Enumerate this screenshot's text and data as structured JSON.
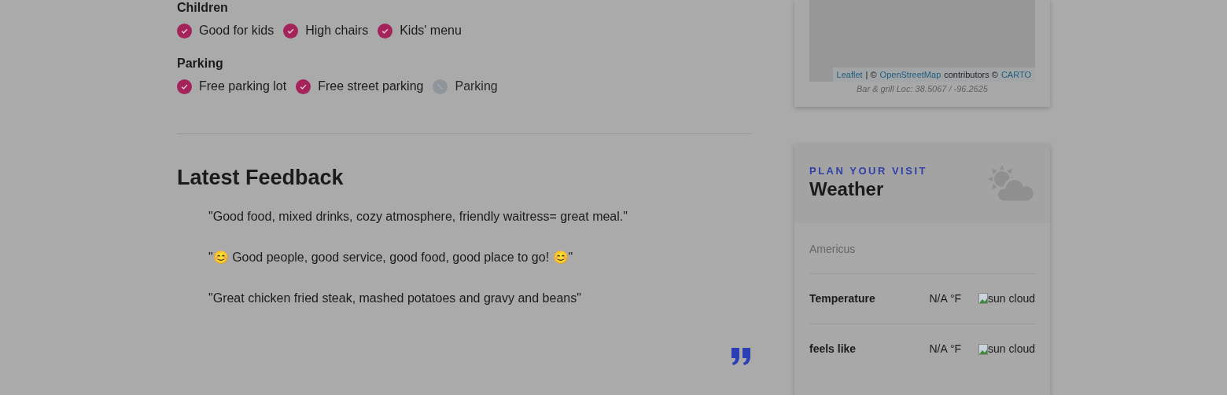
{
  "amenities": [
    {
      "heading": "Children",
      "items": [
        {
          "label": "Good for kids",
          "available": true
        },
        {
          "label": "High chairs",
          "available": true
        },
        {
          "label": "Kids' menu",
          "available": true
        }
      ]
    },
    {
      "heading": "Parking",
      "items": [
        {
          "label": "Free parking lot",
          "available": true
        },
        {
          "label": "Free street parking",
          "available": true
        },
        {
          "label": "Parking",
          "available": false
        }
      ]
    }
  ],
  "feedback": {
    "title": "Latest Feedback",
    "quotes": [
      "\"Good food, mixed drinks, cozy atmosphere, friendly waitress= great meal.\"",
      "\"😊 Good people, good service, good food, good place to go! 😊\"",
      "\"Great chicken fried steak, mashed potatoes and gravy and beans\""
    ]
  },
  "map": {
    "attribution": [
      {
        "text": "Leaflet",
        "link": true
      },
      {
        "text": "| ©",
        "link": false
      },
      {
        "text": "OpenStreetMap",
        "link": true
      },
      {
        "text": "contributors ©",
        "link": false
      },
      {
        "text": "CARTO",
        "link": true
      }
    ],
    "caption": "Bar & grill Loc: 38.5067 / -96.2625"
  },
  "weather": {
    "eyebrow": "PLAN YOUR VISIT",
    "title": "Weather",
    "city": "Americus",
    "rows": [
      {
        "label": "Temperature",
        "value": "N/A °F",
        "image_alt": "sun cloud"
      },
      {
        "label": "feels like",
        "value": "N/A °F",
        "image_alt": "sun cloud"
      }
    ]
  }
}
